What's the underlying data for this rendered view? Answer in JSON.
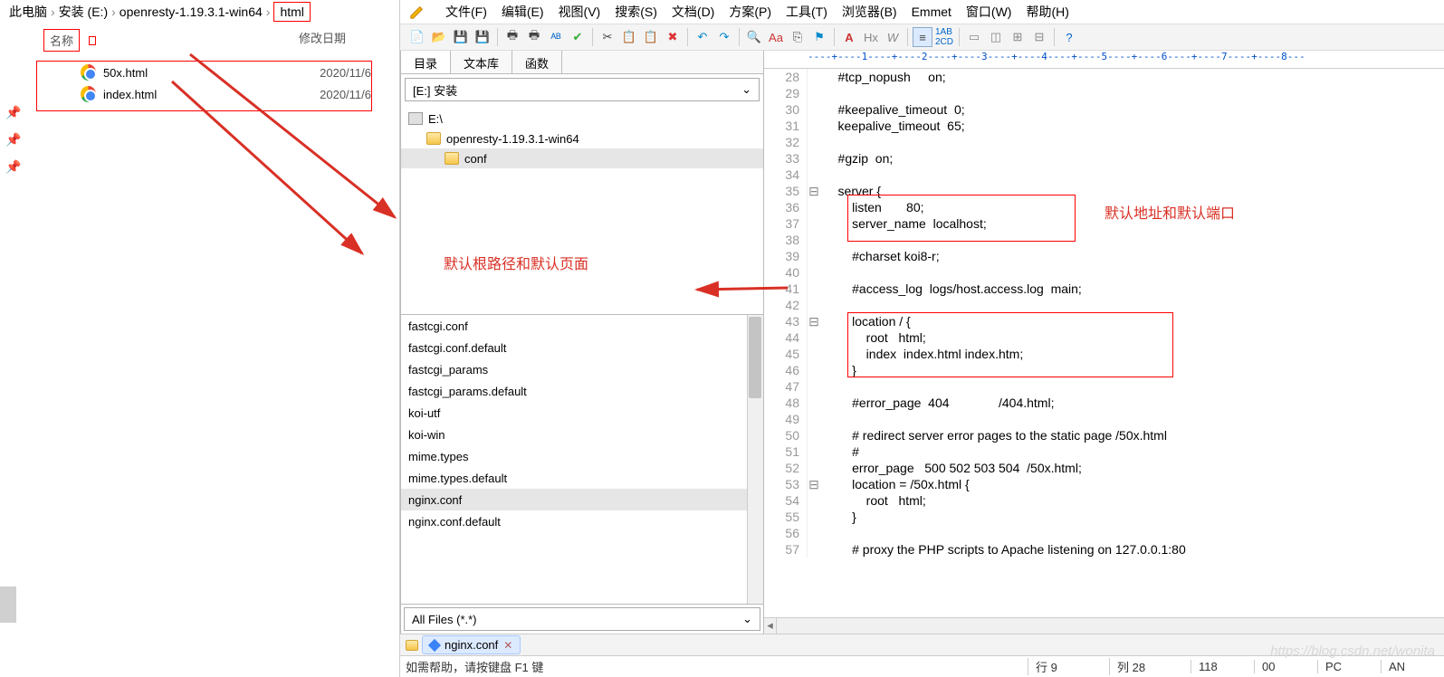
{
  "explorer": {
    "breadcrumbs": [
      "此电脑",
      "安装 (E:)",
      "openresty-1.19.3.1-win64",
      "html"
    ],
    "columns": {
      "name": "名称",
      "date": "修改日期"
    },
    "files": [
      {
        "name": "50x.html",
        "date": "2020/11/6"
      },
      {
        "name": "index.html",
        "date": "2020/11/6"
      }
    ]
  },
  "annotations": {
    "left": "默认根路径和默认页面",
    "right": "默认地址和默认端口"
  },
  "menu": {
    "items": [
      "文件(F)",
      "编辑(E)",
      "视图(V)",
      "搜索(S)",
      "文档(D)",
      "方案(P)",
      "工具(T)",
      "浏览器(B)",
      "Emmet",
      "窗口(W)",
      "帮助(H)"
    ]
  },
  "side": {
    "tabs": [
      "目录",
      "文本库",
      "函数"
    ],
    "combo": "[E:] 安装",
    "tree": [
      {
        "label": "E:\\",
        "depth": 0,
        "type": "drive"
      },
      {
        "label": "openresty-1.19.3.1-win64",
        "depth": 1,
        "type": "folder"
      },
      {
        "label": "conf",
        "depth": 2,
        "type": "folder",
        "selected": true
      }
    ],
    "files": [
      "fastcgi.conf",
      "fastcgi.conf.default",
      "fastcgi_params",
      "fastcgi_params.default",
      "koi-utf",
      "koi-win",
      "mime.types",
      "mime.types.default",
      "nginx.conf",
      "nginx.conf.default"
    ],
    "selected_file": "nginx.conf",
    "filter": "All Files (*.*)"
  },
  "code": {
    "lines": [
      {
        "n": 28,
        "t": "    #tcp_nopush     on;"
      },
      {
        "n": 29,
        "t": ""
      },
      {
        "n": 30,
        "t": "    #keepalive_timeout  0;"
      },
      {
        "n": 31,
        "t": "    keepalive_timeout  65;"
      },
      {
        "n": 32,
        "t": ""
      },
      {
        "n": 33,
        "t": "    #gzip  on;"
      },
      {
        "n": 34,
        "t": ""
      },
      {
        "n": 35,
        "t": "    server {",
        "fold": "⊟"
      },
      {
        "n": 36,
        "t": "        listen       80;"
      },
      {
        "n": 37,
        "t": "        server_name  localhost;"
      },
      {
        "n": 38,
        "t": ""
      },
      {
        "n": 39,
        "t": "        #charset koi8-r;"
      },
      {
        "n": 40,
        "t": ""
      },
      {
        "n": 41,
        "t": "        #access_log  logs/host.access.log  main;"
      },
      {
        "n": 42,
        "t": ""
      },
      {
        "n": 43,
        "t": "        location / {",
        "fold": "⊟"
      },
      {
        "n": 44,
        "t": "            root   html;"
      },
      {
        "n": 45,
        "t": "            index  index.html index.htm;"
      },
      {
        "n": 46,
        "t": "        }"
      },
      {
        "n": 47,
        "t": ""
      },
      {
        "n": 48,
        "t": "        #error_page  404              /404.html;"
      },
      {
        "n": 49,
        "t": ""
      },
      {
        "n": 50,
        "t": "        # redirect server error pages to the static page /50x.html"
      },
      {
        "n": 51,
        "t": "        #"
      },
      {
        "n": 52,
        "t": "        error_page   500 502 503 504  /50x.html;"
      },
      {
        "n": 53,
        "t": "        location = /50x.html {",
        "fold": "⊟"
      },
      {
        "n": 54,
        "t": "            root   html;"
      },
      {
        "n": 55,
        "t": "        }"
      },
      {
        "n": 56,
        "t": ""
      },
      {
        "n": 57,
        "t": "        # proxy the PHP scripts to Apache listening on 127.0.0.1:80"
      }
    ],
    "ruler": "----+----1----+----2----+----3----+----4----+----5----+----6----+----7----+----8---"
  },
  "doctab": {
    "name": "nginx.conf"
  },
  "status": {
    "help": "如需帮助，请按键盘 F1 键",
    "line_label": "行 9",
    "col_label": "列 28",
    "num1": "118",
    "num2": "00",
    "mode": "PC",
    "enc": "AN"
  },
  "watermark": "https://blog.csdn.net/wonita"
}
